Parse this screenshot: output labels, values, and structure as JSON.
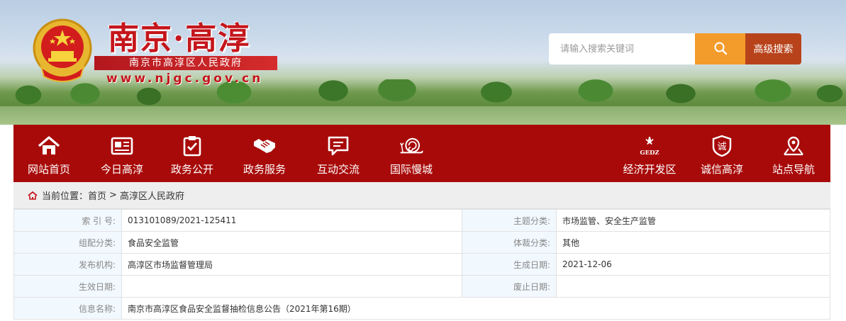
{
  "header": {
    "site_title": "南京·高淳",
    "site_subtitle": "南京市高淳区人民政府",
    "site_domain": "www.njgc.gov.cn",
    "emblem_icon": "national-emblem-icon"
  },
  "search": {
    "placeholder": "请输入搜索关键词",
    "value": "",
    "search_icon": "search-icon",
    "advanced_label": "高级搜索"
  },
  "nav": {
    "items": [
      {
        "label": "网站首页",
        "icon": "home-icon"
      },
      {
        "label": "今日高淳",
        "icon": "newspaper-icon"
      },
      {
        "label": "政务公开",
        "icon": "checklist-icon"
      },
      {
        "label": "政务服务",
        "icon": "handshake-icon"
      },
      {
        "label": "互动交流",
        "icon": "chat-icon"
      },
      {
        "label": "国际慢城",
        "icon": "snail-icon"
      },
      {
        "label": "经济开发区",
        "icon": "gedz-logo-icon",
        "logo_text": "GEDZ"
      },
      {
        "label": "诚信高淳",
        "icon": "integrity-badge-icon",
        "badge_text": "诚"
      },
      {
        "label": "站点导航",
        "icon": "location-pin-icon"
      }
    ]
  },
  "breadcrumb": {
    "prefix": "当前位置：",
    "items": [
      "首页",
      "高淳区人民政府"
    ],
    "separator": ">"
  },
  "info": {
    "index_no_label": "索 引 号:",
    "index_no": "013101089/2021-125411",
    "topic_label": "主题分类:",
    "topic": "市场监管、安全生产监管",
    "org_category_label": "组配分类:",
    "org_category": "食品安全监管",
    "genre_label": "体裁分类:",
    "genre": "其他",
    "publisher_label": "发布机构:",
    "publisher": "高淳区市场监督管理局",
    "created_label": "生成日期:",
    "created": "2021-12-06",
    "effective_label": "生效日期:",
    "effective": "",
    "expired_label": "废止日期:",
    "expired": "",
    "name_label": "信息名称:",
    "name": "南京市高淳区食品安全监督抽检信息公告（2021年第16期）"
  },
  "colors": {
    "nav_bg": "#a80a0a",
    "title_red": "#c4161c",
    "search_orange": "#f39b2b",
    "advanced_brown": "#b8431b",
    "label_cell_bg": "#f1f8fe"
  }
}
